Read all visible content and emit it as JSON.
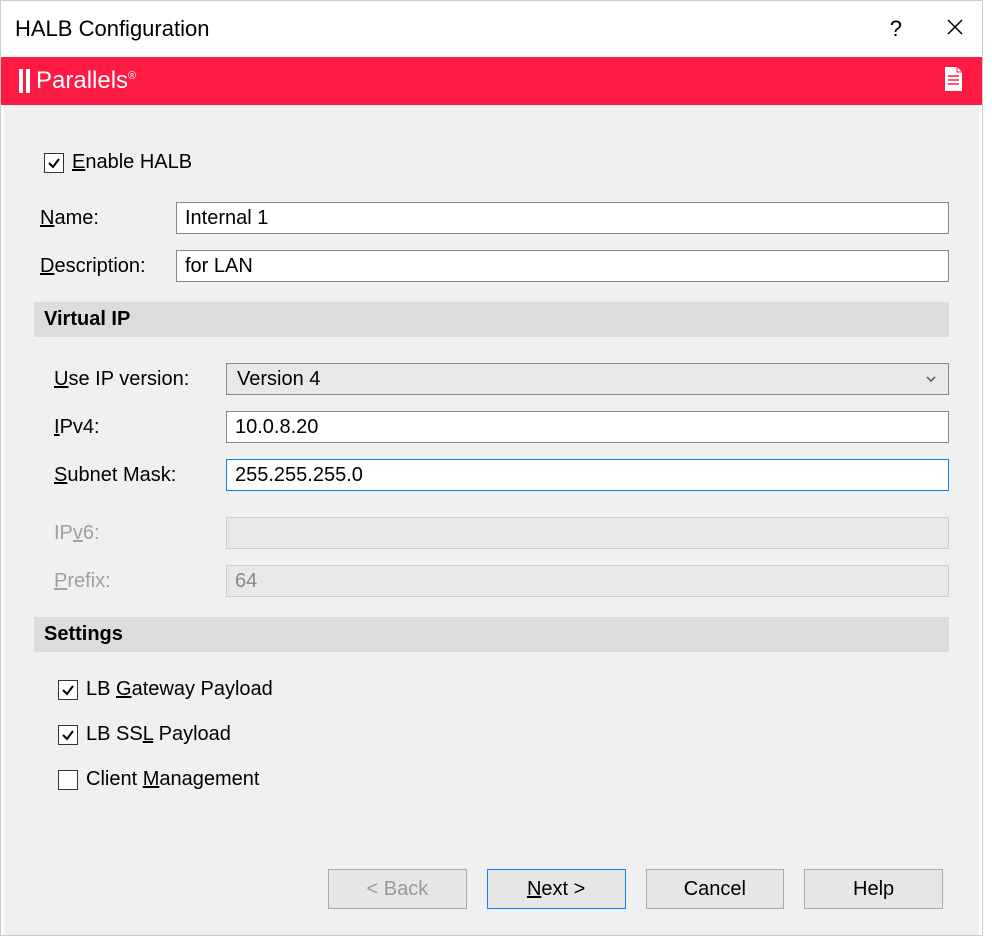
{
  "window": {
    "title": "HALB Configuration"
  },
  "brand": {
    "name": "Parallels",
    "reg": "®"
  },
  "enable": {
    "label_pre": "E",
    "label_post": "nable HALB",
    "checked": true
  },
  "fields": {
    "name": {
      "label_pre": "N",
      "label_post": "ame:",
      "value": "Internal 1"
    },
    "description": {
      "label_pre": "D",
      "label_post": "escription:",
      "value": "for LAN"
    }
  },
  "sections": {
    "virtual_ip": "Virtual IP",
    "settings": "Settings"
  },
  "vip": {
    "version": {
      "label_pre": "U",
      "label_post": "se IP version:",
      "selected": "Version 4"
    },
    "ipv4": {
      "label_pre": "I",
      "label_post": "Pv4:",
      "value": "10.0.8.20"
    },
    "subnet": {
      "label_pre": "S",
      "label_post": "ubnet Mask:",
      "value": "255.255.255.0"
    },
    "ipv6": {
      "label_pre": "IP",
      "label_post": "v",
      "label_post2": "6:",
      "value": ""
    },
    "prefix": {
      "label_pre": "P",
      "label_post": "refix:",
      "value": "64"
    }
  },
  "settings_opts": {
    "gateway": {
      "label_pre": "LB ",
      "label_u": "G",
      "label_post": "ateway Payload",
      "checked": true
    },
    "ssl": {
      "label_pre": "LB SS",
      "label_u": "L",
      "label_post": " Payload",
      "checked": true
    },
    "client": {
      "label_pre": "Client ",
      "label_u": "M",
      "label_post": "anagement",
      "checked": false
    }
  },
  "buttons": {
    "back": "< Back",
    "next_pre": "N",
    "next_post": "ext >",
    "cancel": "Cancel",
    "help": "Help"
  }
}
